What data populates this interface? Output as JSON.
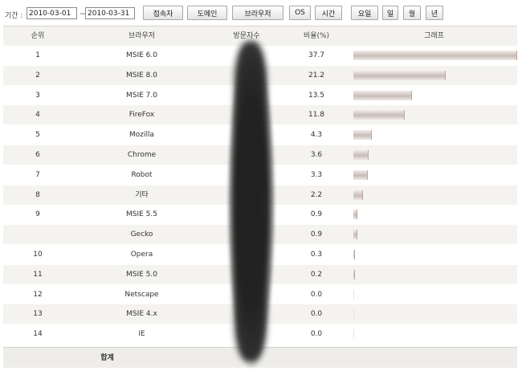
{
  "filter": {
    "period_label": "기간 :",
    "start_date": "2010-03-01",
    "separator": "~",
    "end_date": "2010-03-31",
    "buttons": [
      "접속자",
      "도메인",
      "브라우저",
      "OS",
      "시간",
      "요일",
      "일",
      "월",
      "년"
    ]
  },
  "table": {
    "headers": [
      "순위",
      "브라우저",
      "방문자수",
      "비율(%)",
      "그래프"
    ],
    "rows": [
      {
        "rank": "1",
        "browser": "MSIE 6.0",
        "ratio": "37.7",
        "ratio_value": 37.7
      },
      {
        "rank": "2",
        "browser": "MSIE 8.0",
        "ratio": "21.2",
        "ratio_value": 21.2
      },
      {
        "rank": "3",
        "browser": "MSIE 7.0",
        "ratio": "13.5",
        "ratio_value": 13.5
      },
      {
        "rank": "4",
        "browser": "FireFox",
        "ratio": "11.8",
        "ratio_value": 11.8
      },
      {
        "rank": "5",
        "browser": "Mozilla",
        "ratio": "4.3",
        "ratio_value": 4.3
      },
      {
        "rank": "6",
        "browser": "Chrome",
        "ratio": "3.6",
        "ratio_value": 3.6
      },
      {
        "rank": "7",
        "browser": "Robot",
        "ratio": "3.3",
        "ratio_value": 3.3
      },
      {
        "rank": "8",
        "browser": "기타",
        "ratio": "2.2",
        "ratio_value": 2.2
      },
      {
        "rank": "9",
        "browser": "MSIE 5.5",
        "ratio": "0.9",
        "ratio_value": 0.9
      },
      {
        "rank": "",
        "browser": "Gecko",
        "ratio": "0.9",
        "ratio_value": 0.9
      },
      {
        "rank": "10",
        "browser": "Opera",
        "ratio": "0.3",
        "ratio_value": 0.3
      },
      {
        "rank": "11",
        "browser": "MSIE 5.0",
        "ratio": "0.2",
        "ratio_value": 0.2
      },
      {
        "rank": "12",
        "browser": "Netscape",
        "ratio": "0.0",
        "ratio_value": 0.0
      },
      {
        "rank": "13",
        "browser": "MSIE 4.x",
        "ratio": "0.0",
        "ratio_value": 0.0
      },
      {
        "rank": "14",
        "browser": "IE",
        "ratio": "0.0",
        "ratio_value": 0.0
      }
    ],
    "total_label": "합계"
  },
  "colors": {
    "bar": "#c9bcb6",
    "alt_row": "#f4f3f0",
    "header_row": "#f3f2ef"
  }
}
